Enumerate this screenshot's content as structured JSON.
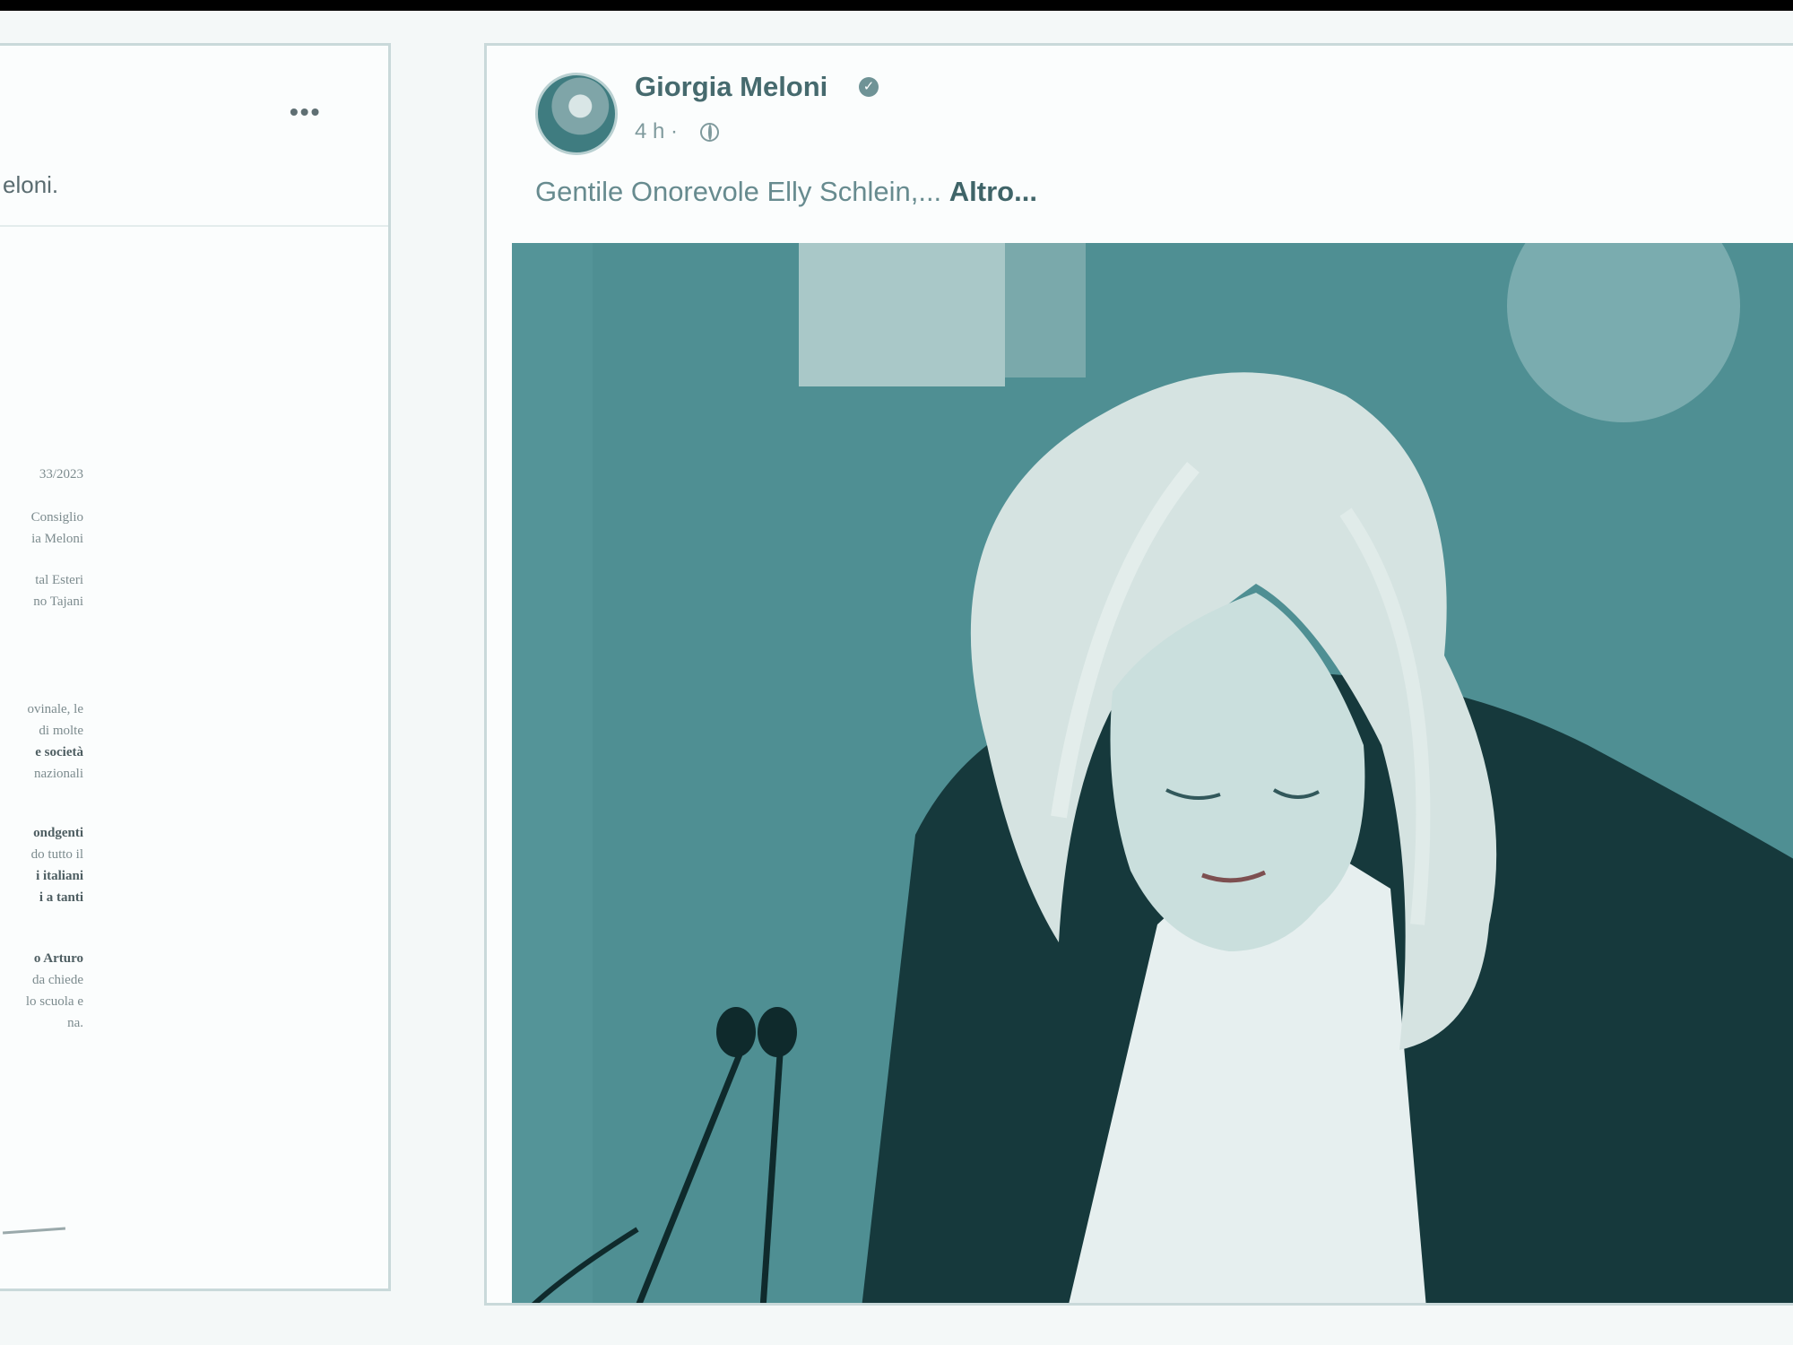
{
  "left_post": {
    "more_label": "•••",
    "caption_fragment": "eloni.",
    "letter_lines": [
      {
        "text": "33/2023",
        "bold": false
      },
      {
        "text": "Consiglio",
        "bold": false
      },
      {
        "text": "ia Meloni",
        "bold": false
      },
      {
        "text": "tal Esteri",
        "bold": false
      },
      {
        "text": "no Tajani",
        "bold": false
      },
      {
        "text": "ovinale, le",
        "bold": false
      },
      {
        "text": "di molte",
        "bold": false
      },
      {
        "text": "e società",
        "bold": true
      },
      {
        "text": "nazionali",
        "bold": false
      },
      {
        "text": "ondgenti",
        "bold": true
      },
      {
        "text": "do tutto il",
        "bold": false
      },
      {
        "text": "i italiani",
        "bold": true
      },
      {
        "text": "i a tanti",
        "bold": true
      },
      {
        "text": "o Arturo",
        "bold": true
      },
      {
        "text": "da chiede",
        "bold": false
      },
      {
        "text": "lo scuola e",
        "bold": false
      },
      {
        "text": "na.",
        "bold": false
      }
    ]
  },
  "right_post": {
    "author": "Giorgia Meloni",
    "verified_icon": "verified-badge",
    "time": "4 h ·",
    "privacy_icon": "globe-icon",
    "text": "Gentile Onorevole Elly Schlein,...",
    "more_link": "Altro..."
  },
  "colors": {
    "accent": "#4f8f93",
    "text_dark": "#466a6e"
  }
}
